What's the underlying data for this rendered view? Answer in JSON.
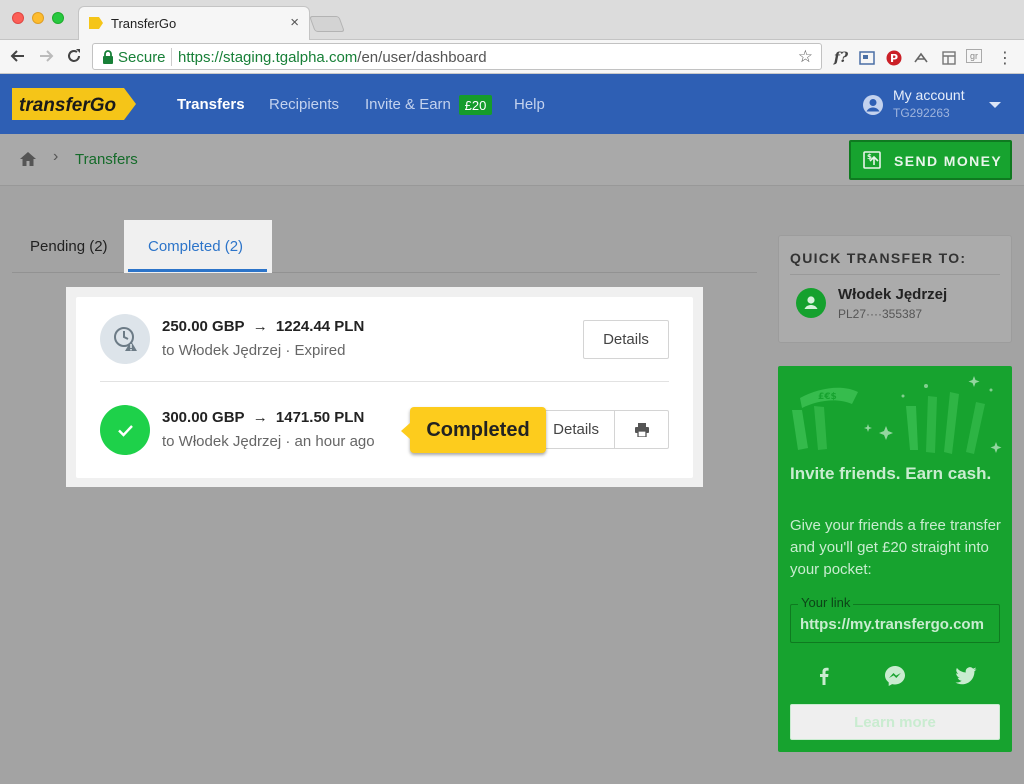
{
  "browser": {
    "tab_title": "TransferGo",
    "tab_close": "×",
    "secure_label": "Secure",
    "url_scheme": "https://",
    "url_host": "staging.tgalpha.com",
    "url_path": "/en/user/dashboard",
    "extensions": [
      "f?",
      "pinterest",
      "rss",
      "reader",
      "gr"
    ]
  },
  "header": {
    "logo_text": "transferGo",
    "nav": {
      "transfers": "Transfers",
      "recipients": "Recipients",
      "invite": "Invite & Earn",
      "invite_badge": "£20",
      "help": "Help"
    },
    "account": {
      "name": "My account",
      "id": "TG292263"
    }
  },
  "breadcrumb": {
    "current": "Transfers",
    "separator": "›"
  },
  "send_money": {
    "label": "SEND MONEY"
  },
  "tabs": {
    "pending": "Pending (2)",
    "completed": "Completed (2)"
  },
  "transfers": [
    {
      "from": "250.00 GBP",
      "arrow": "→",
      "to": "1224.44 PLN",
      "detail": "to Włodek Jędrzej · Expired",
      "status": "expired",
      "details_label": "Details"
    },
    {
      "from": "300.00 GBP",
      "arrow": "→",
      "to": "1471.50 PLN",
      "detail": "to Włodek Jędrzej · an hour ago",
      "status": "completed",
      "details_label": "Details"
    }
  ],
  "tooltip": {
    "label": "Completed"
  },
  "quick_transfer": {
    "title": "QUICK TRANSFER TO:",
    "name": "Włodek Jędrzej",
    "account": "PL27····355387"
  },
  "invite": {
    "title": "Invite friends. Earn cash.",
    "text": "Give your friends a free transfer and you'll get £20 straight into your pocket:",
    "link_label": "Your link",
    "link_value": "https://my.transfergo.com",
    "learn_more": "Learn more"
  },
  "colors": {
    "header_blue": "#2e5fb4",
    "brand_green": "#17a32f",
    "accent_blue": "#2c74c9",
    "tooltip_yellow": "#fdcc1d",
    "success_green": "#1ed14a"
  }
}
